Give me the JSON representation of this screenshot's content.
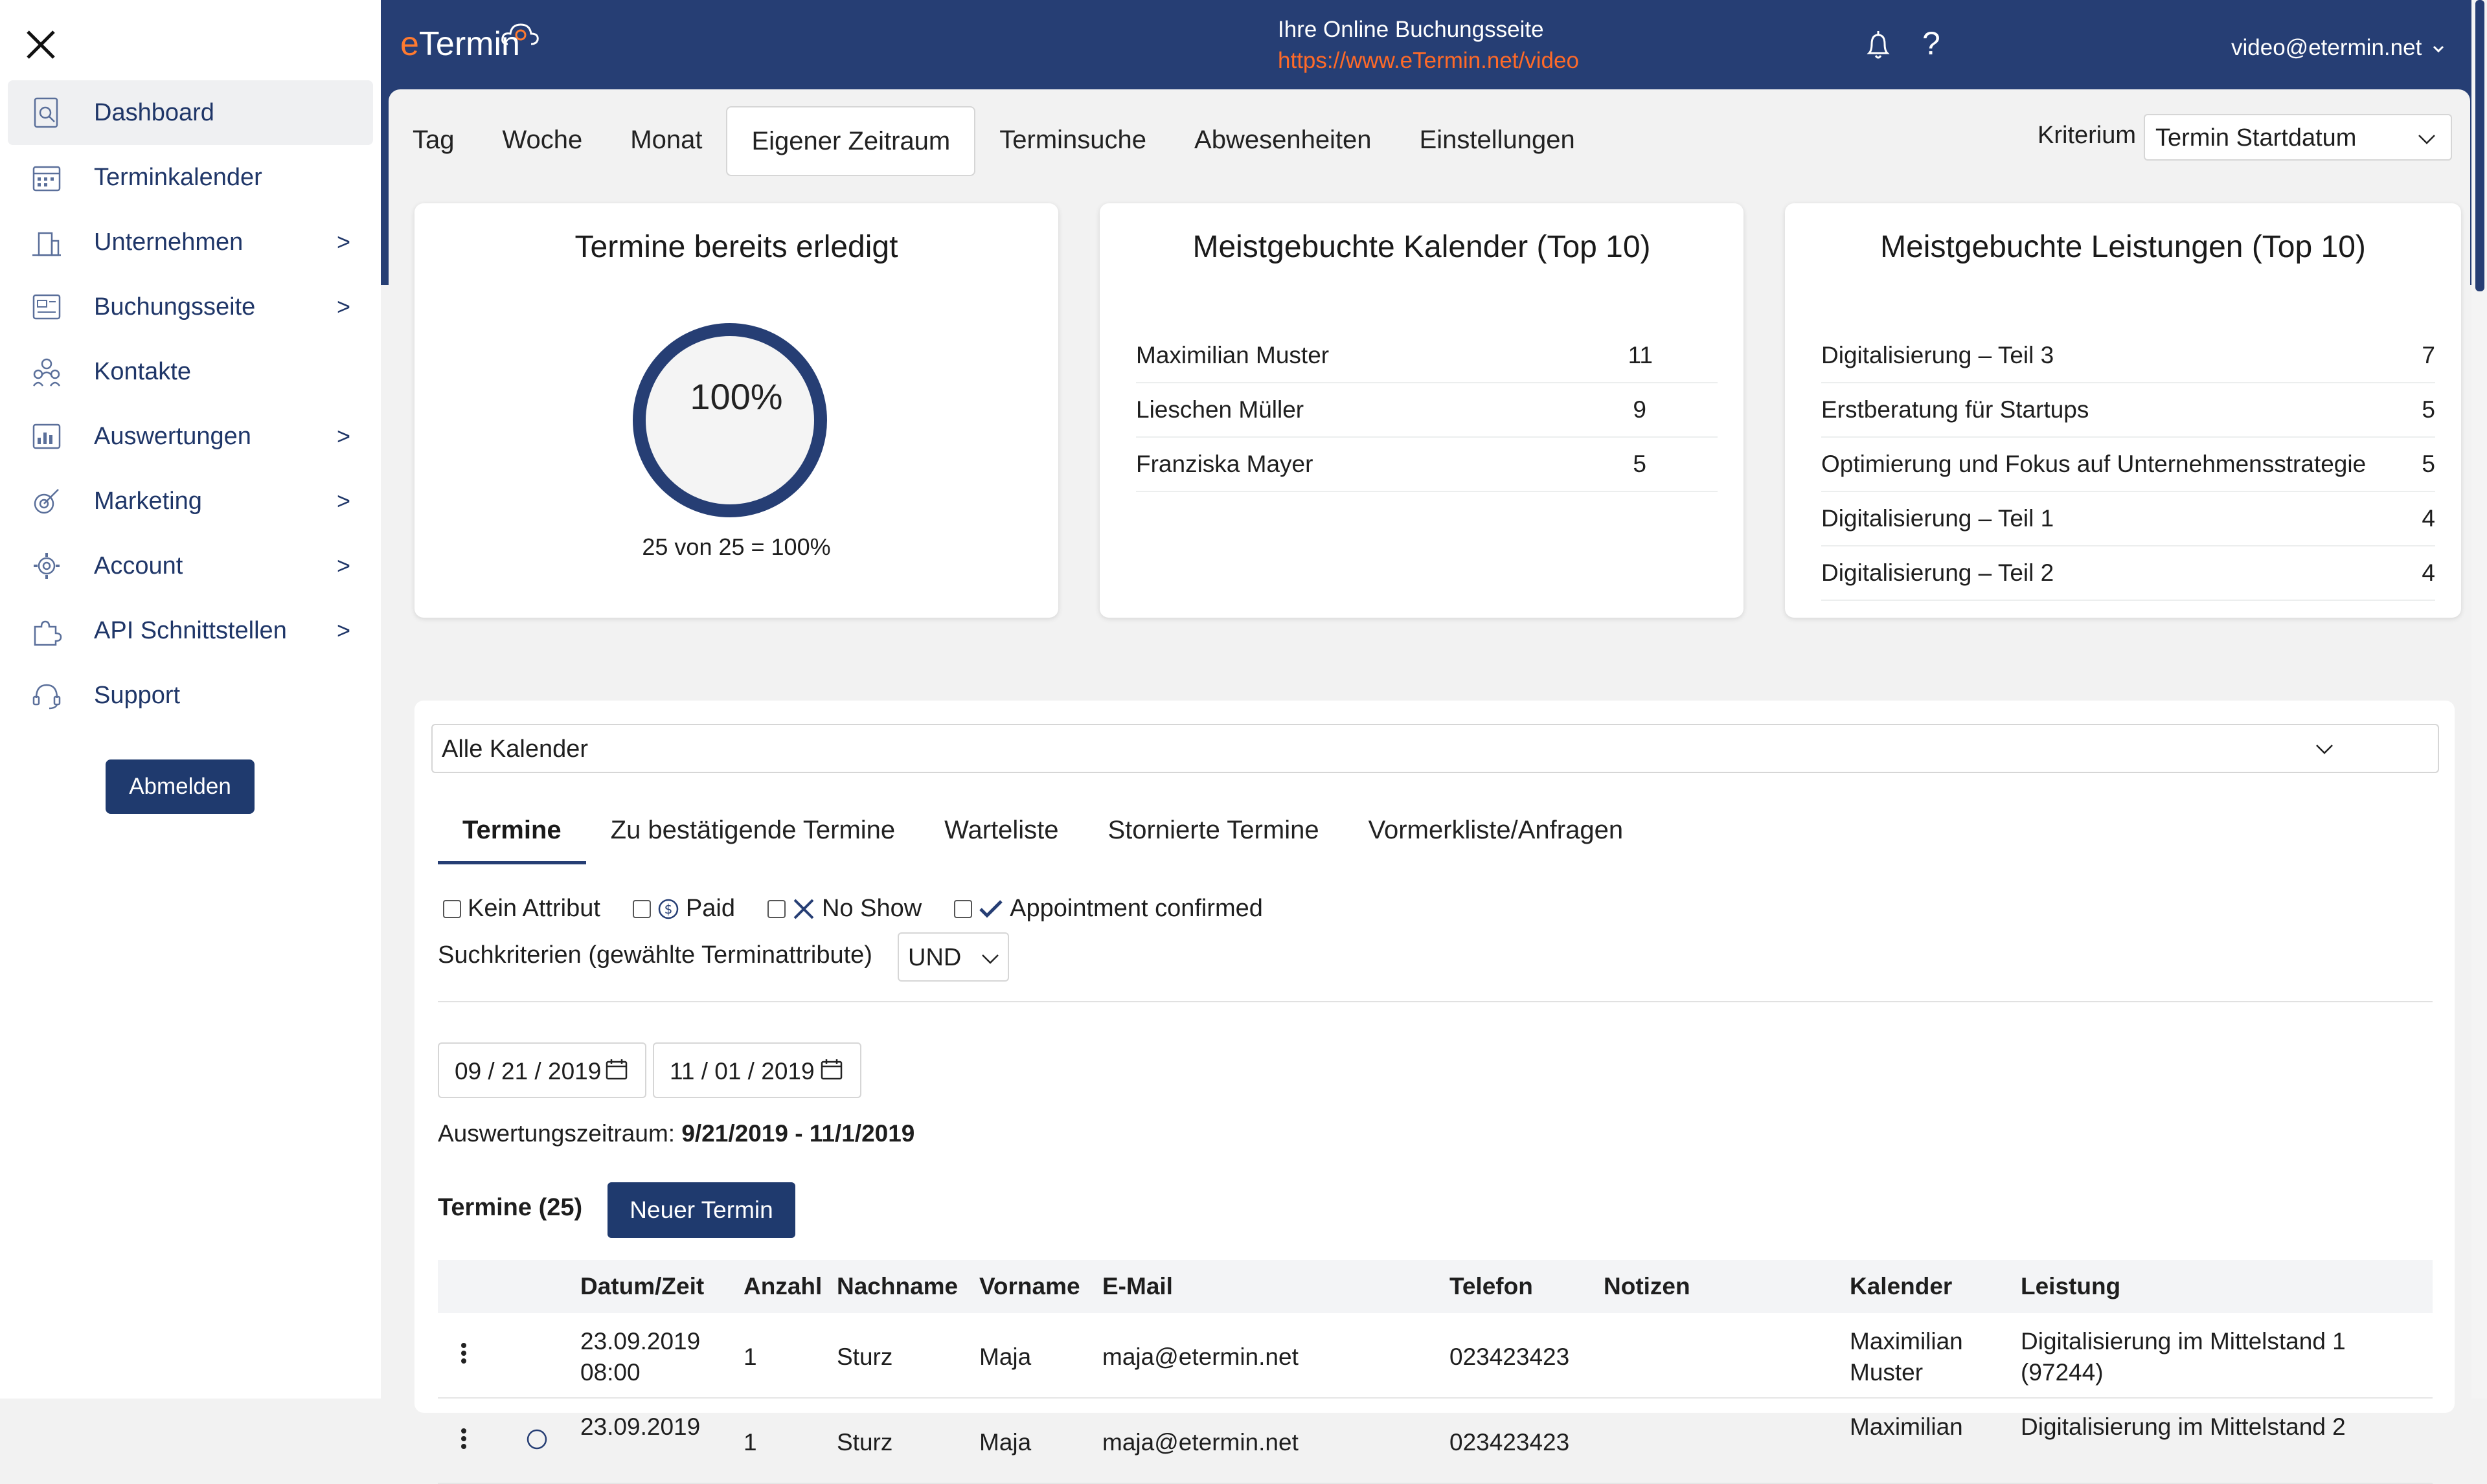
{
  "sidebar": {
    "items": [
      {
        "label": "Dashboard",
        "icon": "dashboard-icon",
        "arrow": ""
      },
      {
        "label": "Terminkalender",
        "icon": "calendar-icon",
        "arrow": ""
      },
      {
        "label": "Unternehmen",
        "icon": "company-icon",
        "arrow": ">"
      },
      {
        "label": "Buchungsseite",
        "icon": "booking-page-icon",
        "arrow": ">"
      },
      {
        "label": "Kontakte",
        "icon": "contacts-icon",
        "arrow": ""
      },
      {
        "label": "Auswertungen",
        "icon": "reports-icon",
        "arrow": ">"
      },
      {
        "label": "Marketing",
        "icon": "marketing-icon",
        "arrow": ">"
      },
      {
        "label": "Account",
        "icon": "account-gear-icon",
        "arrow": ">"
      },
      {
        "label": "API Schnittstellen",
        "icon": "api-puzzle-icon",
        "arrow": ">"
      },
      {
        "label": "Support",
        "icon": "support-headset-icon",
        "arrow": ""
      }
    ],
    "logout_label": "Abmelden"
  },
  "header": {
    "logo_e": "e",
    "logo_rest": "Termin",
    "title": "Ihre Online Buchungsseite",
    "link": "https://www.eTermin.net/video",
    "user": "video@etermin.net",
    "help": "?"
  },
  "view_tabs": [
    "Tag",
    "Woche",
    "Monat",
    "Eigener Zeitraum",
    "Terminsuche",
    "Abwesenheiten",
    "Einstellungen"
  ],
  "kriterium": {
    "label": "Kriterium",
    "value": "Termin Startdatum"
  },
  "cards": {
    "done": {
      "title": "Termine bereits erledigt",
      "percent": "100%",
      "caption": "25 von 25 = 100%",
      "fraction": 1.0
    },
    "calendars": {
      "title": "Meistgebuchte Kalender (Top 10)",
      "rows": [
        {
          "name": "Maximilian Muster",
          "count": "11"
        },
        {
          "name": "Lieschen Müller",
          "count": "9"
        },
        {
          "name": "Franziska Mayer",
          "count": "5"
        }
      ]
    },
    "services": {
      "title": "Meistgebuchte Leistungen (Top 10)",
      "rows": [
        {
          "name": "Digitalisierung – Teil 3",
          "count": "7"
        },
        {
          "name": "Erstberatung für Startups",
          "count": "5"
        },
        {
          "name": "Optimierung und Fokus auf Unternehmensstrategie",
          "count": "5"
        },
        {
          "name": "Digitalisierung – Teil 1",
          "count": "4"
        },
        {
          "name": "Digitalisierung – Teil 2",
          "count": "4"
        }
      ]
    }
  },
  "calendar_filter": "Alle Kalender",
  "sub_tabs": [
    "Termine",
    "Zu bestätigende Termine",
    "Warteliste",
    "Stornierte Termine",
    "Vormerkliste/Anfragen"
  ],
  "attributes": [
    "Kein Attribut",
    "Paid",
    "No Show",
    "Appointment confirmed"
  ],
  "search_criteria": {
    "label": "Suchkriterien (gewählte Terminattribute)",
    "value": "UND"
  },
  "dates": {
    "from": "09 / 21 / 2019",
    "to": "11 / 01 / 2019"
  },
  "period": {
    "label": "Auswertungszeitraum:",
    "value": "9/21/2019 - 11/1/2019"
  },
  "appointments": {
    "count_label": "Termine (25)",
    "new_label": "Neuer Termin"
  },
  "table": {
    "headers": [
      "Datum/Zeit",
      "Anzahl",
      "Nachname",
      "Vorname",
      "E-Mail",
      "Telefon",
      "Notizen",
      "Kalender",
      "Leistung"
    ],
    "rows": [
      {
        "date": "23.09.2019",
        "time": "08:00",
        "count": "1",
        "last": "Sturz",
        "first": "Maja",
        "email": "maja@etermin.net",
        "phone": "023423423",
        "notes": "",
        "cal1": "Maximilian",
        "cal2": "Muster",
        "svc1": "Digitalisierung im Mittelstand 1",
        "svc2": "(97244)"
      },
      {
        "date": "23.09.2019",
        "time": "",
        "count": "1",
        "last": "Sturz",
        "first": "Maja",
        "email": "maja@etermin.net",
        "phone": "023423423",
        "notes": "",
        "cal1": "Maximilian",
        "cal2": "",
        "svc1": "Digitalisierung im Mittelstand 2",
        "svc2": ""
      }
    ]
  },
  "colors": {
    "primary": "#263e74",
    "accent": "#ff6a28",
    "button": "#1f3a6e"
  }
}
